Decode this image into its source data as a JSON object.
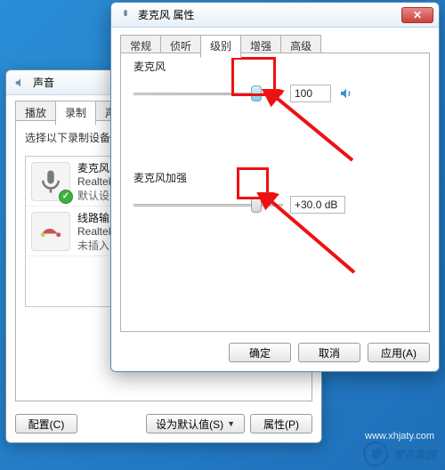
{
  "sound_window": {
    "title": "声音",
    "tabs": [
      "播放",
      "录制",
      "声音"
    ],
    "active_tab_index": 1,
    "hint": "选择以下录制设备来修改",
    "devices": [
      {
        "name": "麦克风",
        "driver": "Realtek Hi",
        "status": "默认设备",
        "default": true
      },
      {
        "name": "线路输入",
        "driver": "Realtek Hi",
        "status": "未插入",
        "default": false
      }
    ],
    "buttons": {
      "configure": "配置(C)",
      "set_default": "设为默认值(S)",
      "properties": "属性(P)"
    }
  },
  "props_window": {
    "title": "麦克风 属性",
    "tabs": [
      "常规",
      "侦听",
      "级别",
      "增强",
      "高级"
    ],
    "active_tab_index": 2,
    "sections": {
      "mic": {
        "label": "麦克风",
        "value": "100",
        "pos_pct": 82
      },
      "boost": {
        "label": "麦克风加强",
        "value": "+30.0 dB",
        "pos_pct": 82
      }
    },
    "buttons": {
      "ok": "确定",
      "cancel": "取消",
      "apply": "应用(A)"
    }
  },
  "colors": {
    "highlight": "#e11"
  },
  "watermark": {
    "text": "雪花家园",
    "url": "www.xhjaty.com"
  }
}
